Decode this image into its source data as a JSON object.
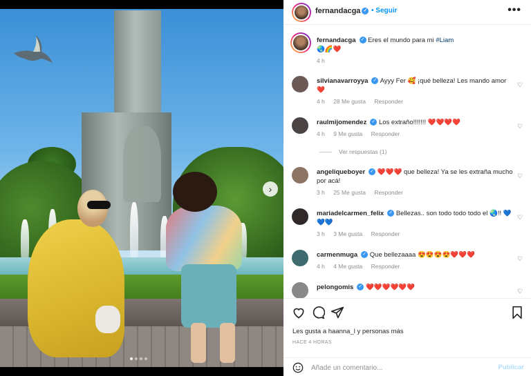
{
  "post": {
    "username": "fernandacga",
    "follow_label": "Seguir",
    "more_label": "•••"
  },
  "caption": {
    "username": "fernandacga",
    "text": "Eres el mundo para mi",
    "hashtag": "#Liam",
    "emojis": "🌏🌈❤️",
    "time": "4 h"
  },
  "comments": [
    {
      "username": "silvianavarroyya",
      "text": "Ayyy Fer 🥰 ¡qué belleza! Les mando amor ❤️",
      "time": "4 h",
      "likes": "28 Me gusta",
      "reply": "Responder"
    },
    {
      "username": "raulmijomendez",
      "text": "Los extraño!!!!!!! ❤️❤️❤️❤️",
      "time": "4 h",
      "likes": "9 Me gusta",
      "reply": "Responder",
      "view_replies": "Ver respuestas (1)"
    },
    {
      "username": "angeliqueboyer",
      "text": "❤️❤️❤️ que belleza! Ya se les extraña mucho por acá!",
      "time": "3 h",
      "likes": "25 Me gusta",
      "reply": "Responder"
    },
    {
      "username": "mariadelcarmen_felix",
      "text": "Bellezas.. son todo todo todo el 🌏!! 💙💙💙",
      "time": "3 h",
      "likes": "3 Me gusta",
      "reply": "Responder"
    },
    {
      "username": "carmenmuga",
      "text": "Que bellezaaaa 😍😍😍😍❤️❤️❤️",
      "time": "4 h",
      "likes": "4 Me gusta",
      "reply": "Responder"
    },
    {
      "username": "pelongomis",
      "text": "❤️❤️❤️❤️❤️❤️",
      "time": "",
      "likes": "",
      "reply": ""
    }
  ],
  "footer": {
    "likes_text": "Les gusta a haanna_l y personas más",
    "time_caption": "HACE 4 HORAS",
    "comment_placeholder": "Añade un comentario...",
    "publish_label": "Publicar"
  },
  "colors": {
    "accent": "#0095f6",
    "verified": "#3897f0",
    "muted": "#8e8e8e"
  }
}
